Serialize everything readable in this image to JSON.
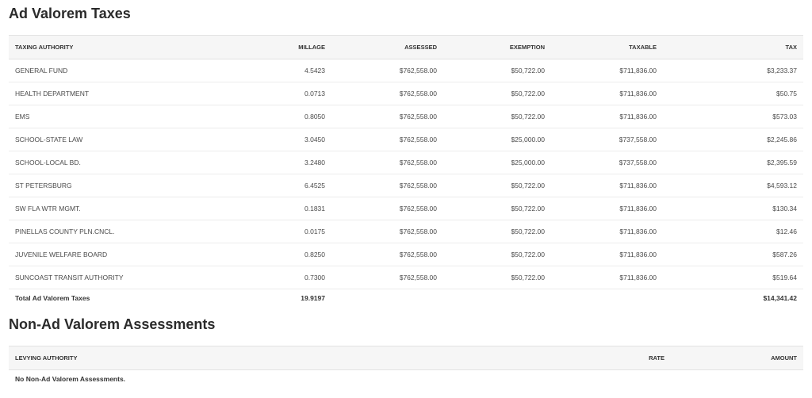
{
  "ad_valorem": {
    "title": "Ad Valorem Taxes",
    "headers": {
      "authority": "TAXING AUTHORITY",
      "millage": "MILLAGE",
      "assessed": "ASSESSED",
      "exemption": "EXEMPTION",
      "taxable": "TAXABLE",
      "tax": "TAX"
    },
    "rows": [
      {
        "authority": "GENERAL FUND",
        "millage": "4.5423",
        "assessed": "$762,558.00",
        "exemption": "$50,722.00",
        "taxable": "$711,836.00",
        "tax": "$3,233.37"
      },
      {
        "authority": "HEALTH DEPARTMENT",
        "millage": "0.0713",
        "assessed": "$762,558.00",
        "exemption": "$50,722.00",
        "taxable": "$711,836.00",
        "tax": "$50.75"
      },
      {
        "authority": "EMS",
        "millage": "0.8050",
        "assessed": "$762,558.00",
        "exemption": "$50,722.00",
        "taxable": "$711,836.00",
        "tax": "$573.03"
      },
      {
        "authority": "SCHOOL-STATE LAW",
        "millage": "3.0450",
        "assessed": "$762,558.00",
        "exemption": "$25,000.00",
        "taxable": "$737,558.00",
        "tax": "$2,245.86"
      },
      {
        "authority": "SCHOOL-LOCAL BD.",
        "millage": "3.2480",
        "assessed": "$762,558.00",
        "exemption": "$25,000.00",
        "taxable": "$737,558.00",
        "tax": "$2,395.59"
      },
      {
        "authority": "ST PETERSBURG",
        "millage": "6.4525",
        "assessed": "$762,558.00",
        "exemption": "$50,722.00",
        "taxable": "$711,836.00",
        "tax": "$4,593.12"
      },
      {
        "authority": "SW FLA WTR MGMT.",
        "millage": "0.1831",
        "assessed": "$762,558.00",
        "exemption": "$50,722.00",
        "taxable": "$711,836.00",
        "tax": "$130.34"
      },
      {
        "authority": "PINELLAS COUNTY PLN.CNCL.",
        "millage": "0.0175",
        "assessed": "$762,558.00",
        "exemption": "$50,722.00",
        "taxable": "$711,836.00",
        "tax": "$12.46"
      },
      {
        "authority": "JUVENILE WELFARE BOARD",
        "millage": "0.8250",
        "assessed": "$762,558.00",
        "exemption": "$50,722.00",
        "taxable": "$711,836.00",
        "tax": "$587.26"
      },
      {
        "authority": "SUNCOAST TRANSIT AUTHORITY",
        "millage": "0.7300",
        "assessed": "$762,558.00",
        "exemption": "$50,722.00",
        "taxable": "$711,836.00",
        "tax": "$519.64"
      }
    ],
    "total": {
      "label": "Total Ad Valorem Taxes",
      "millage": "19.9197",
      "tax": "$14,341.42"
    }
  },
  "non_ad_valorem": {
    "title": "Non-Ad Valorem Assessments",
    "headers": {
      "authority": "LEVYING AUTHORITY",
      "rate": "RATE",
      "amount": "AMOUNT"
    },
    "empty_message": "No Non-Ad Valorem Assessments."
  }
}
